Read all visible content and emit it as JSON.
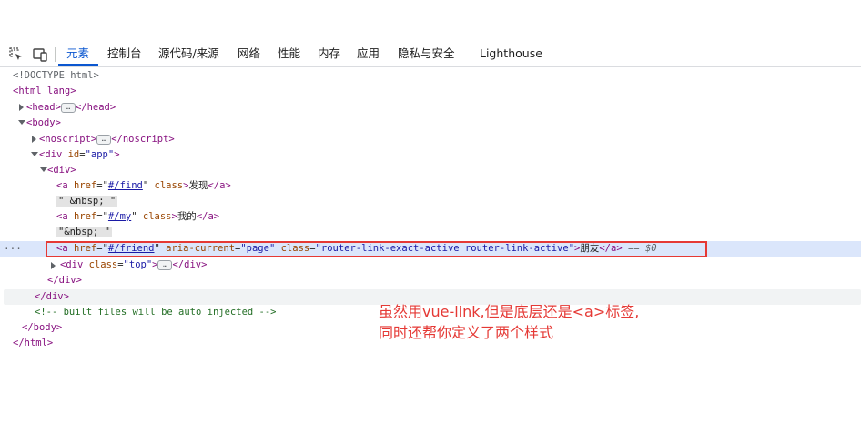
{
  "devtools": {
    "tabs": [
      "元素",
      "控制台",
      "源代码/来源",
      "网络",
      "性能",
      "内存",
      "应用",
      "隐私与安全",
      "Lighthouse"
    ],
    "active_tab": "元素"
  },
  "dom": {
    "doctype": "<!DOCTYPE html>",
    "html_open": "<html lang>",
    "head_open": "<head>",
    "head_close": "</head>",
    "body_open": "<body>",
    "noscript_open": "<noscript>",
    "noscript_close": "</noscript>",
    "div_app_tag": "<div ",
    "div_app_attr": "id",
    "div_app_val": "\"app\"",
    "div_open": "<div>",
    "a_find_href": "#/find",
    "a_find_text": "发现",
    "nbsp1": "\" &nbsp; \"",
    "a_my_href": "#/my",
    "a_my_text": "我的",
    "nbsp2": "\"&nbsp; \"",
    "a_friend_href": "#/friend",
    "a_friend_aria": "\"page\"",
    "a_friend_class": "\"router-link-exact-active router-link-active\"",
    "a_friend_text": "朋友",
    "selected_marker": "== $0",
    "div_top_val": "\"top\"",
    "div_close": "</div>",
    "comment": "<!-- built files will be auto injected -->",
    "body_close": "</body>",
    "html_close": "</html>"
  },
  "annotation": {
    "line1": "虽然用vue-link,但是底层还是<a>标签,",
    "line2": "同时还帮你定义了两个样式"
  },
  "colors": {
    "accent": "#0b57d0",
    "annotation": "#e53935",
    "tag": "#881280",
    "attr_name": "#994500",
    "attr_value": "#1a1aa6"
  }
}
